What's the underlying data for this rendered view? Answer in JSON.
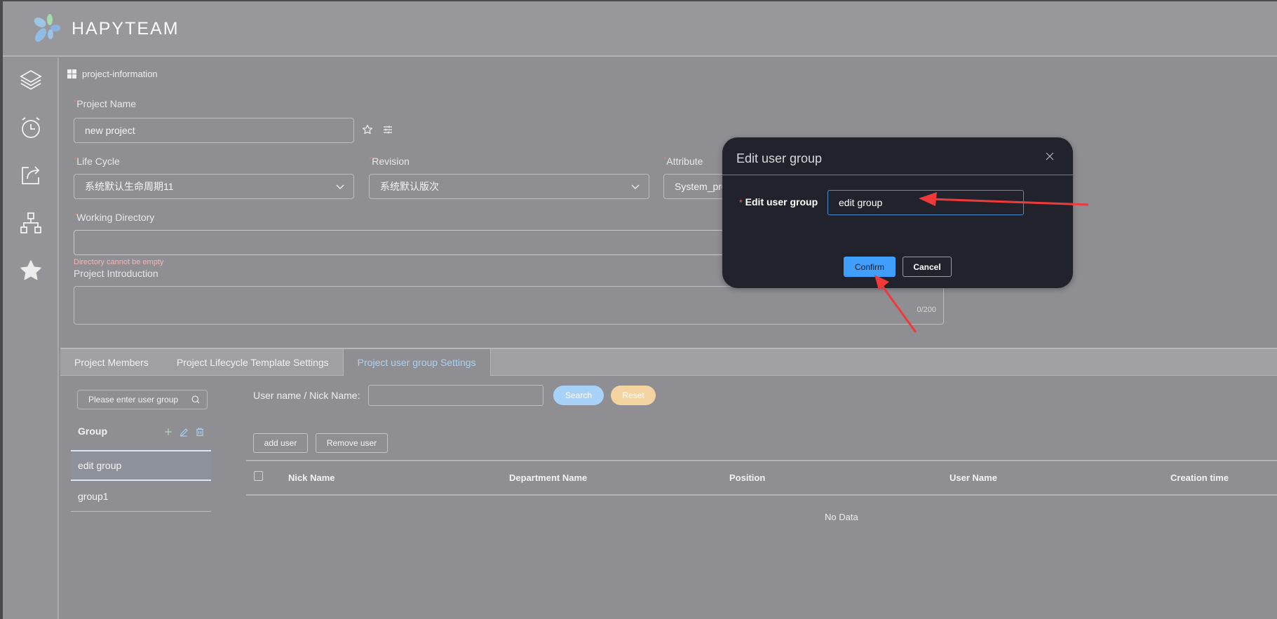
{
  "header": {
    "brand": "HAPYTEAM",
    "logo_icon": "flower-logo-icon"
  },
  "sidebar": {
    "items": [
      {
        "icon": "layers-icon"
      },
      {
        "icon": "alarm-clock-icon"
      },
      {
        "icon": "share-icon"
      },
      {
        "icon": "hierarchy-icon"
      },
      {
        "icon": "star-icon"
      }
    ]
  },
  "breadcrumb": {
    "icon": "grid-icon",
    "label": "project-information"
  },
  "form": {
    "project_name": {
      "label": "Project Name",
      "value": "new project",
      "required": "*"
    },
    "life_cycle": {
      "label": "Life Cycle",
      "value": "系统默认生命周期11",
      "required": "*"
    },
    "revision": {
      "label": "Revision",
      "value": "系统默认版次",
      "required": "*"
    },
    "attribute": {
      "label": "Attribute",
      "value": "System_pro",
      "required": "*"
    },
    "working_directory": {
      "label": "Working Directory",
      "value": "",
      "required": "*",
      "error": "Directory cannot be empty"
    },
    "project_introduction": {
      "label": "Project Introduction",
      "value": "",
      "counter": "0/200"
    }
  },
  "tabs": [
    {
      "label": "Project Members",
      "active": false
    },
    {
      "label": "Project Lifecycle Template Settings",
      "active": false
    },
    {
      "label": "Project user group Settings",
      "active": true
    }
  ],
  "groups": {
    "search_placeholder": "Please enter user group",
    "title": "Group",
    "items": [
      {
        "label": "edit group",
        "selected": true
      },
      {
        "label": "group1",
        "selected": false
      }
    ]
  },
  "filter": {
    "label": "User name / Nick Name:",
    "value": "",
    "search_label": "Search",
    "reset_label": "Reset"
  },
  "actions": {
    "add_user": "add user",
    "remove_user": "Remove user"
  },
  "table": {
    "columns": [
      "Nick Name",
      "Department Name",
      "Position",
      "User Name",
      "Creation time"
    ],
    "rows": [],
    "empty_text": "No Data"
  },
  "dialog": {
    "title": "Edit user group",
    "field_label": "Edit user group",
    "required": "*",
    "field_value": "edit group",
    "confirm_label": "Confirm",
    "cancel_label": "Cancel"
  },
  "colors": {
    "primary": "#409eff",
    "search_pill": "#a8d1f7",
    "reset_pill": "#f3d3a0",
    "dialog_bg": "#22222c",
    "annotation_arrow": "#f03a3a"
  }
}
